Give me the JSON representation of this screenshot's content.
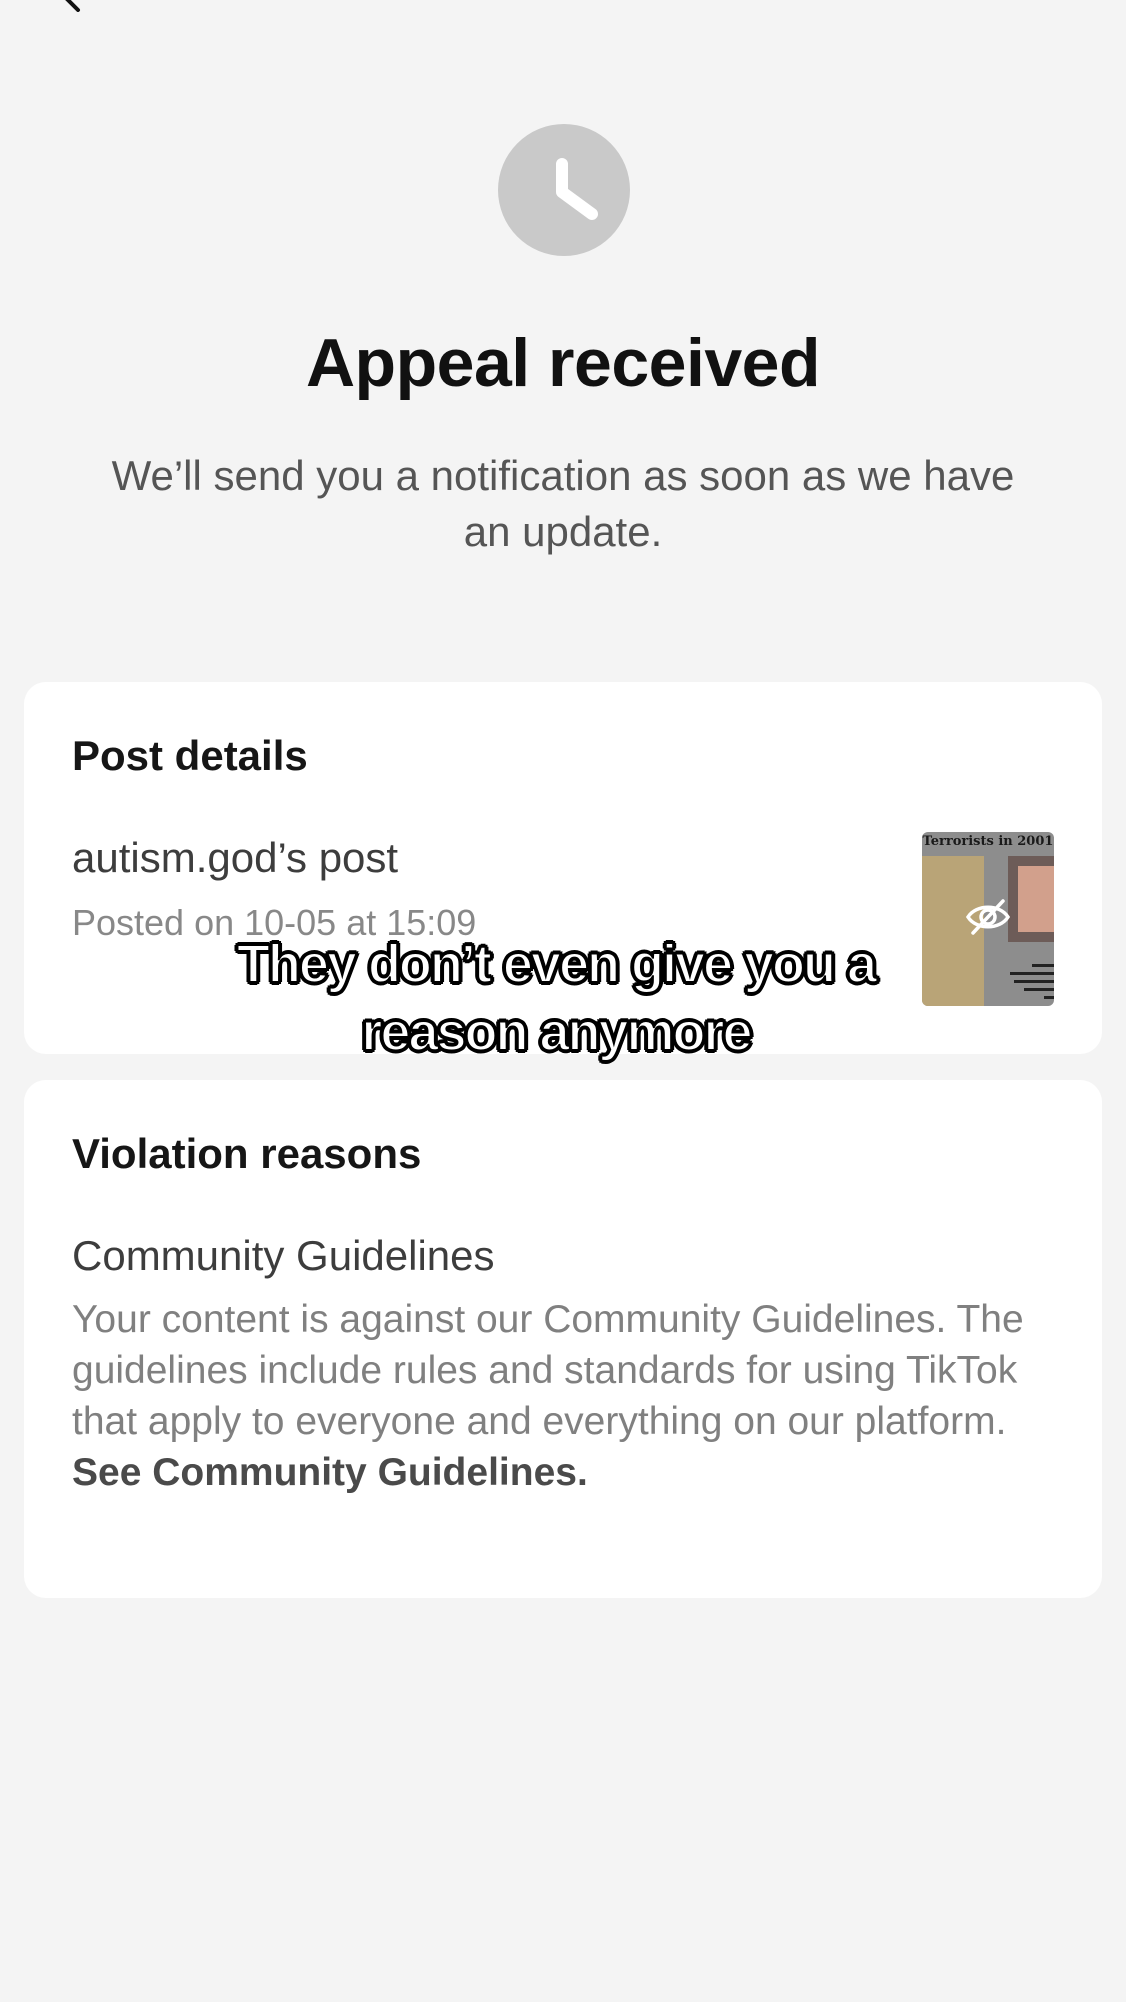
{
  "header": {
    "back_icon": "back-arrow-icon",
    "status_icon": "clock-icon",
    "status_icon_color": "#c9c9c9"
  },
  "main": {
    "title": "Appeal received",
    "subtitle": "We’ll send you a notification as soon as we have an update."
  },
  "post_details": {
    "heading": "Post details",
    "owner": "autism.god’s post",
    "posted": "Posted on 10-05 at 15:09",
    "thumbnail": {
      "text": "Terrorists in 2001",
      "hidden_icon": "eye-slash-icon"
    }
  },
  "violation": {
    "heading": "Violation reasons",
    "title": "Community Guidelines",
    "description": "Your content is against our Community Guidelines. The guidelines include rules and standards for using TikTok that apply to everyone and everything on our platform.",
    "link": "See Community Guidelines."
  },
  "overlay": {
    "caption": "They don’t even give you a reason anymore"
  },
  "colors": {
    "background": "#f4f4f4",
    "card": "#ffffff",
    "title_text": "#111111",
    "muted_text": "#808080"
  }
}
